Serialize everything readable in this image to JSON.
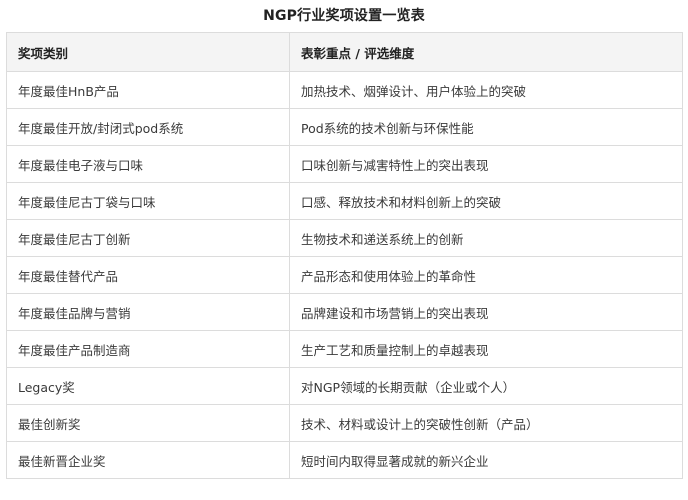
{
  "title": "NGP行业奖项设置一览表",
  "table": {
    "headers": [
      "奖项类别",
      "表彰重点 / 评选维度"
    ],
    "rows": [
      [
        "年度最佳HnB产品",
        "加热技术、烟弹设计、用户体验上的突破"
      ],
      [
        "年度最佳开放/封闭式pod系统",
        "Pod系统的技术创新与环保性能"
      ],
      [
        "年度最佳电子液与口味",
        "口味创新与减害特性上的突出表现"
      ],
      [
        "年度最佳尼古丁袋与口味",
        "口感、释放技术和材料创新上的突破"
      ],
      [
        "年度最佳尼古丁创新",
        "生物技术和递送系统上的创新"
      ],
      [
        "年度最佳替代产品",
        "产品形态和使用体验上的革命性"
      ],
      [
        "年度最佳品牌与营销",
        "品牌建设和市场营销上的突出表现"
      ],
      [
        "年度最佳产品制造商",
        "生产工艺和质量控制上的卓越表现"
      ],
      [
        "Legacy奖",
        "对NGP领域的长期贡献（企业或个人）"
      ],
      [
        "最佳创新奖",
        "技术、材料或设计上的突破性创新（产品）"
      ],
      [
        "最佳新晋企业奖",
        "短时间内取得显著成就的新兴企业"
      ]
    ]
  }
}
